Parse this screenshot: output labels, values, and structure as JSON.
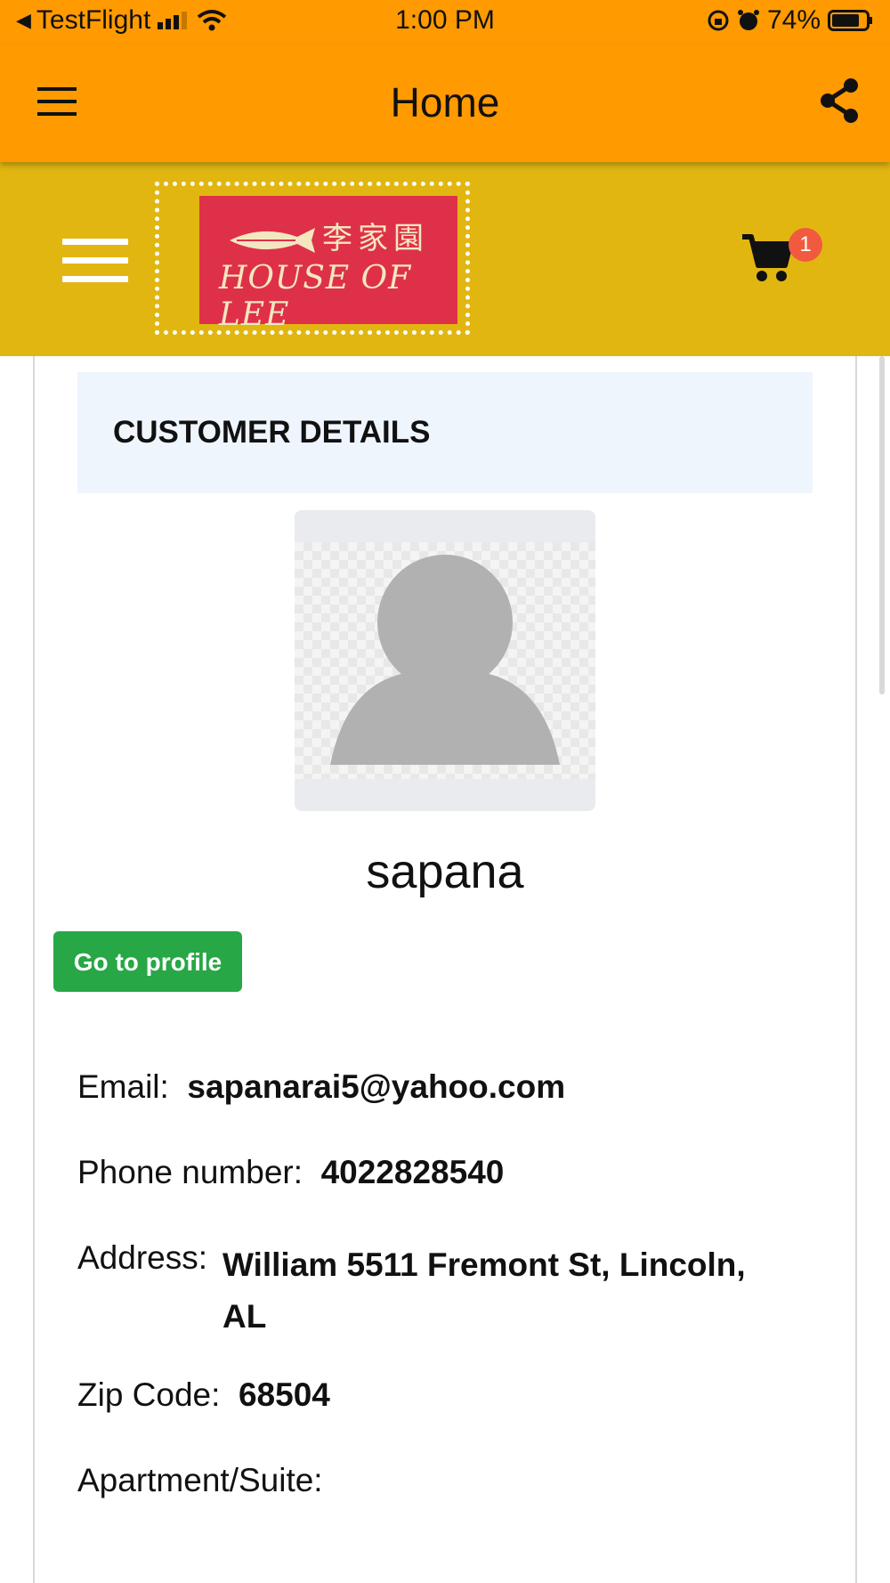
{
  "status_bar": {
    "back_app": "TestFlight",
    "time": "1:00 PM",
    "battery": "74%"
  },
  "app_bar": {
    "title": "Home"
  },
  "site_header": {
    "logo_text": "HOUSE OF LEE",
    "logo_chinese": "李家園",
    "cart_count": "1"
  },
  "customer": {
    "section_title": "CUSTOMER DETAILS",
    "name": "sapana",
    "profile_button": "Go to profile",
    "email_label": "Email:",
    "email": "sapanarai5@yahoo.com",
    "phone_label": "Phone number:",
    "phone": "4022828540",
    "address_label": "Address:",
    "address": "William 5511 Fremont St, Lincoln, AL",
    "zip_label": "Zip Code:",
    "zip": "68504",
    "apt_label": "Apartment/Suite:",
    "apt": ""
  },
  "colors": {
    "app_bar": "#ff9a00",
    "site_header": "#e1b611",
    "logo_bg": "#de3149",
    "profile_button": "#27a745",
    "cart_badge": "#f15a3f"
  }
}
